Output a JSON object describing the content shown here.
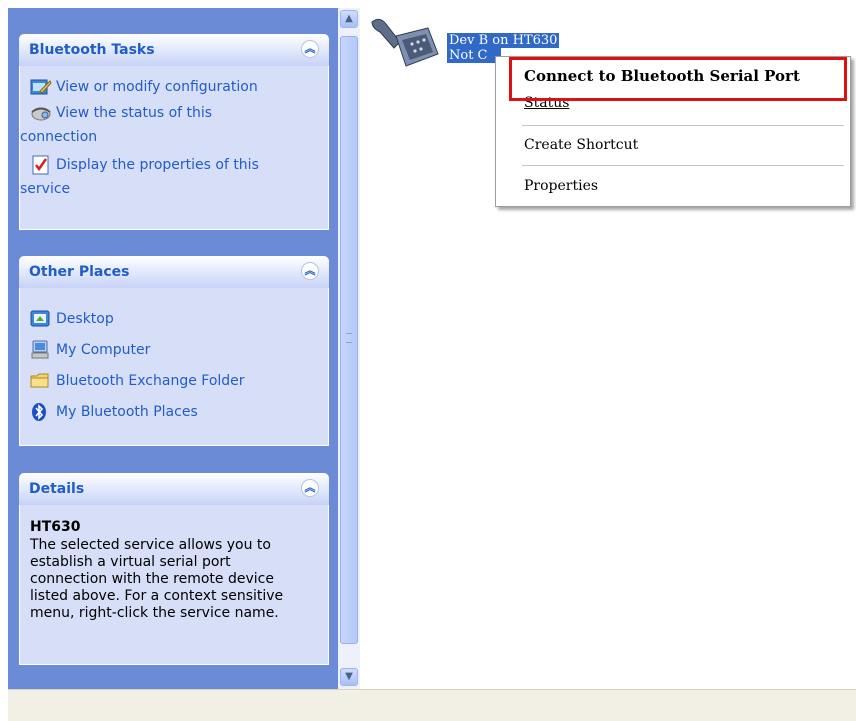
{
  "task_pane": {
    "bluetooth_tasks": {
      "title": "Bluetooth Tasks",
      "items": [
        {
          "label_line1": "View or modify configuration",
          "icon": "configure-icon"
        },
        {
          "label_line1": "View the status of this",
          "label_line2": "connection",
          "icon": "status-icon"
        },
        {
          "label_line1": "Display the properties of this",
          "label_line2": "service",
          "icon": "properties-icon"
        }
      ]
    },
    "other_places": {
      "title": "Other Places",
      "items": [
        {
          "label": "Desktop",
          "icon": "desktop-icon"
        },
        {
          "label": "My Computer",
          "icon": "my-computer-icon"
        },
        {
          "label": "Bluetooth Exchange Folder",
          "icon": "folder-icon"
        },
        {
          "label": "My Bluetooth Places",
          "icon": "bluetooth-icon"
        }
      ]
    },
    "details": {
      "title": "Details",
      "name": "HT630",
      "description_lines": [
        "The selected service allows you to",
        "establish a virtual serial port",
        "connection with the remote device",
        "listed above. For a context sensitive",
        "menu, right-click the service name."
      ]
    }
  },
  "content": {
    "item": {
      "name": "Dev B on HT630",
      "status": "Not Connected",
      "status_visible": "Not C",
      "icon": "serial-port-icon"
    }
  },
  "context_menu": {
    "items": [
      {
        "label": "Connect to Bluetooth Serial Port",
        "bold": true
      },
      {
        "label": "Status"
      },
      {
        "label": "Create Shortcut"
      },
      {
        "label": "Properties"
      }
    ]
  },
  "colors": {
    "pane_bg": "#6b8bd6",
    "link": "#215dc6",
    "highlight_border": "#e01010",
    "selection": "#3169c6"
  }
}
